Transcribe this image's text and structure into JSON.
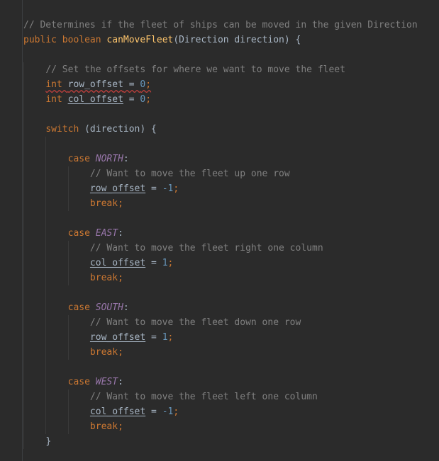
{
  "editor": {
    "lines": [
      [
        {
          "t": "// Determines if the fleet of ships can be moved in the given Direction",
          "c": "comment"
        }
      ],
      [
        {
          "t": "public ",
          "c": "kw"
        },
        {
          "t": "boolean ",
          "c": "kw"
        },
        {
          "t": "canMoveFleet",
          "c": "method"
        },
        {
          "t": "(Direction direction) {",
          "c": "plain"
        }
      ],
      [],
      [
        {
          "t": "    ",
          "c": "plain"
        },
        {
          "t": "// Set the offsets for where we want to move the fleet",
          "c": "comment"
        }
      ],
      [
        {
          "t": "    ",
          "c": "plain"
        },
        {
          "t": "int ",
          "c": "kw squiggle"
        },
        {
          "t": "row_offset",
          "c": "plain squiggle"
        },
        {
          "t": " = ",
          "c": "plain squiggle"
        },
        {
          "t": "0",
          "c": "num squiggle"
        },
        {
          "t": ";",
          "c": "kw squiggle"
        }
      ],
      [
        {
          "t": "    ",
          "c": "plain"
        },
        {
          "t": "int ",
          "c": "kw"
        },
        {
          "t": "col_offset",
          "c": "plain field"
        },
        {
          "t": " = ",
          "c": "plain"
        },
        {
          "t": "0",
          "c": "num"
        },
        {
          "t": ";",
          "c": "kw"
        }
      ],
      [],
      [
        {
          "t": "    ",
          "c": "plain"
        },
        {
          "t": "switch ",
          "c": "kw"
        },
        {
          "t": "(direction) {",
          "c": "plain"
        }
      ],
      [],
      [
        {
          "t": "        ",
          "c": "plain"
        },
        {
          "t": "case ",
          "c": "kw"
        },
        {
          "t": "NORTH",
          "c": "enum"
        },
        {
          "t": ":",
          "c": "plain"
        }
      ],
      [
        {
          "t": "            ",
          "c": "plain"
        },
        {
          "t": "// Want to move the fleet up one row",
          "c": "comment"
        }
      ],
      [
        {
          "t": "            ",
          "c": "plain"
        },
        {
          "t": "row_offset",
          "c": "plain field"
        },
        {
          "t": " = ",
          "c": "plain"
        },
        {
          "t": "-1",
          "c": "num"
        },
        {
          "t": ";",
          "c": "kw"
        }
      ],
      [
        {
          "t": "            ",
          "c": "plain"
        },
        {
          "t": "break",
          "c": "kw"
        },
        {
          "t": ";",
          "c": "kw"
        }
      ],
      [],
      [
        {
          "t": "        ",
          "c": "plain"
        },
        {
          "t": "case ",
          "c": "kw"
        },
        {
          "t": "EAST",
          "c": "enum"
        },
        {
          "t": ":",
          "c": "plain"
        }
      ],
      [
        {
          "t": "            ",
          "c": "plain"
        },
        {
          "t": "// Want to move the fleet right one column",
          "c": "comment"
        }
      ],
      [
        {
          "t": "            ",
          "c": "plain"
        },
        {
          "t": "col_offset",
          "c": "plain field"
        },
        {
          "t": " = ",
          "c": "plain"
        },
        {
          "t": "1",
          "c": "num"
        },
        {
          "t": ";",
          "c": "kw"
        }
      ],
      [
        {
          "t": "            ",
          "c": "plain"
        },
        {
          "t": "break",
          "c": "kw"
        },
        {
          "t": ";",
          "c": "kw"
        }
      ],
      [],
      [
        {
          "t": "        ",
          "c": "plain"
        },
        {
          "t": "case ",
          "c": "kw"
        },
        {
          "t": "SOUTH",
          "c": "enum"
        },
        {
          "t": ":",
          "c": "plain"
        }
      ],
      [
        {
          "t": "            ",
          "c": "plain"
        },
        {
          "t": "// Want to move the fleet down one row",
          "c": "comment"
        }
      ],
      [
        {
          "t": "            ",
          "c": "plain"
        },
        {
          "t": "row_offset",
          "c": "plain field"
        },
        {
          "t": " = ",
          "c": "plain"
        },
        {
          "t": "1",
          "c": "num"
        },
        {
          "t": ";",
          "c": "kw"
        }
      ],
      [
        {
          "t": "            ",
          "c": "plain"
        },
        {
          "t": "break",
          "c": "kw"
        },
        {
          "t": ";",
          "c": "kw"
        }
      ],
      [],
      [
        {
          "t": "        ",
          "c": "plain"
        },
        {
          "t": "case ",
          "c": "kw"
        },
        {
          "t": "WEST",
          "c": "enum"
        },
        {
          "t": ":",
          "c": "plain"
        }
      ],
      [
        {
          "t": "            ",
          "c": "plain"
        },
        {
          "t": "// Want to move the fleet left one column",
          "c": "comment"
        }
      ],
      [
        {
          "t": "            ",
          "c": "plain"
        },
        {
          "t": "col_offset",
          "c": "plain field"
        },
        {
          "t": " = ",
          "c": "plain"
        },
        {
          "t": "-1",
          "c": "num"
        },
        {
          "t": ";",
          "c": "kw"
        }
      ],
      [
        {
          "t": "            ",
          "c": "plain"
        },
        {
          "t": "break",
          "c": "kw"
        },
        {
          "t": ";",
          "c": "kw"
        }
      ],
      [
        {
          "t": "    ",
          "c": "plain"
        },
        {
          "t": "}",
          "c": "plain"
        }
      ]
    ]
  }
}
